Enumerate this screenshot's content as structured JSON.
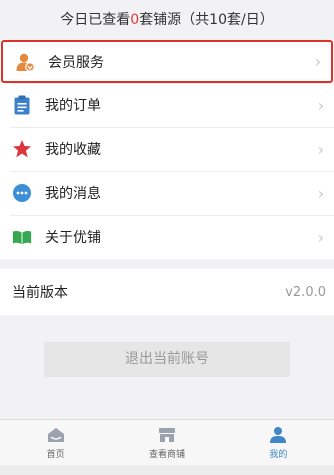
{
  "quota": {
    "prefix": "今日已查看",
    "count": "0",
    "suffix": "套铺源（共10套/日）"
  },
  "menu": {
    "items": [
      {
        "label": "会员服务",
        "icon": "member-user-icon",
        "color": "#e5893f"
      },
      {
        "label": "我的订单",
        "icon": "clipboard-icon",
        "color": "#3b82c8"
      },
      {
        "label": "我的收藏",
        "icon": "star-icon",
        "color": "#d9383e"
      },
      {
        "label": "我的消息",
        "icon": "chat-bubble-icon",
        "color": "#3b8fd6"
      },
      {
        "label": "关于优铺",
        "icon": "book-icon",
        "color": "#36a852"
      }
    ]
  },
  "version": {
    "label": "当前版本",
    "value": "v2.0.0"
  },
  "logout": {
    "label": "退出当前账号"
  },
  "tabbar": {
    "tabs": [
      {
        "label": "首页",
        "icon": "home-icon",
        "active": false
      },
      {
        "label": "查看商铺",
        "icon": "shop-icon",
        "active": false
      },
      {
        "label": "我的",
        "icon": "profile-icon",
        "active": true
      }
    ]
  },
  "colors": {
    "accent": "#3e86c9",
    "highlight_border": "#d9332a",
    "quota_count": "#e53935"
  }
}
